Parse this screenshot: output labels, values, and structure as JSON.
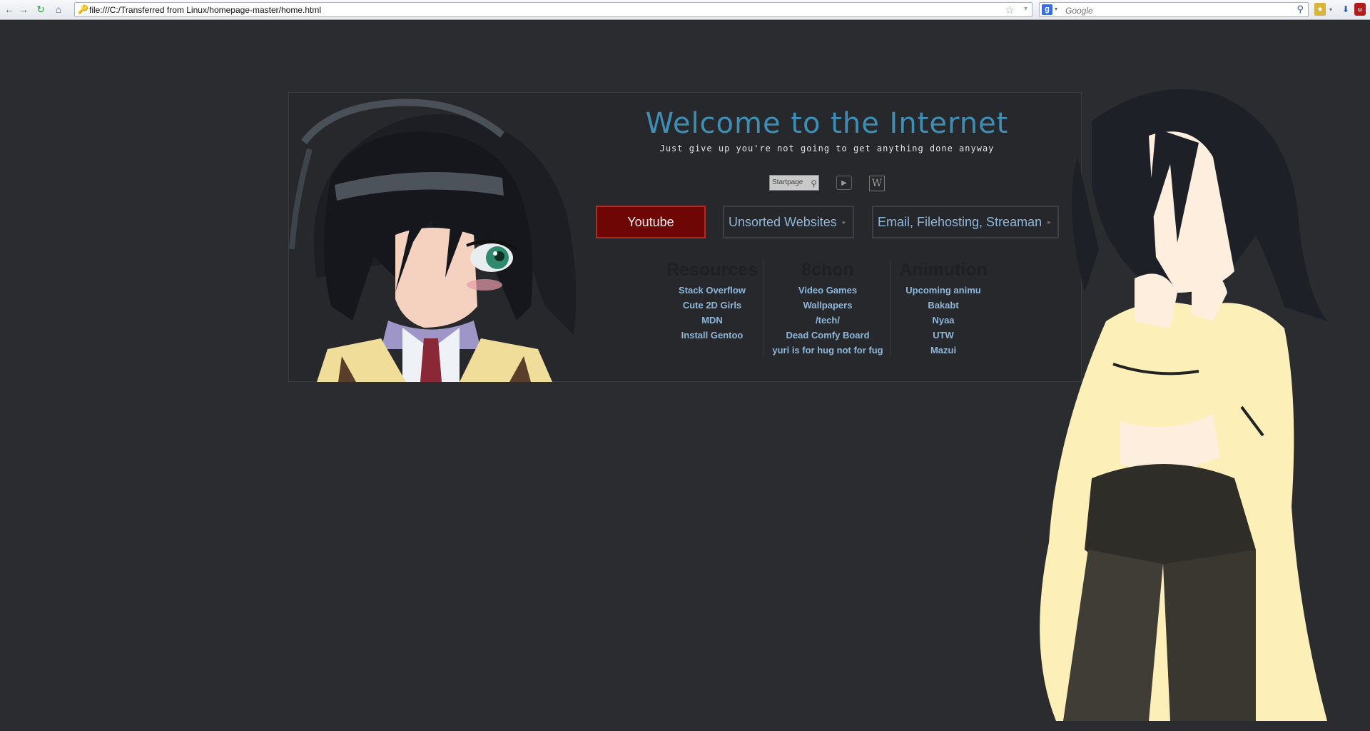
{
  "browser": {
    "url": "file:///C:/Transferred from Linux/homepage-master/home.html",
    "search_placeholder": "Google",
    "search_engine_letter": "g"
  },
  "page": {
    "title": "Welcome to the Internet",
    "subtitle": "Just give up you're not going to get anything done anyway",
    "quick_icons": {
      "startpage_label": "Startpage"
    },
    "tabs": [
      {
        "label": "Youtube"
      },
      {
        "label": "Unsorted Websites"
      },
      {
        "label": "Email, Filehosting, Streaman"
      }
    ],
    "columns": [
      {
        "heading": "Resources",
        "links": [
          "Stack Overflow",
          "Cute 2D Girls",
          "MDN",
          "Install Gentoo"
        ]
      },
      {
        "heading": "8chon",
        "links": [
          "Video Games",
          "Wallpapers",
          "/tech/",
          "Dead Comfy Board",
          "yuri is for hug not for fug"
        ]
      },
      {
        "heading": "Animution",
        "links": [
          "Upcoming animu",
          "Bakabt",
          "Nyaa",
          "UTW",
          "Mazui"
        ]
      }
    ]
  },
  "colors": {
    "background": "#2b2c30",
    "accent": "#3d8fb5",
    "link": "#8fb7d9",
    "youtube_tab": "#6e0605"
  }
}
